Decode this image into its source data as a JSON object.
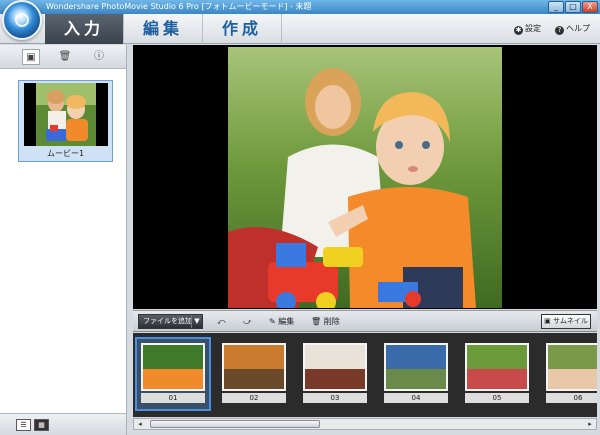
{
  "window": {
    "title": "Wondershare PhotoMovie Studio 6 Pro [フォトムービーモード] - 未題",
    "min": "_",
    "max": "□",
    "close": "X"
  },
  "tabs": [
    {
      "label": "入力"
    },
    {
      "label": "編集"
    },
    {
      "label": "作成"
    }
  ],
  "toolbar": {
    "settings": "設定",
    "help": "ヘルプ"
  },
  "sidebar": {
    "movie_label": "ムービー1"
  },
  "controls": {
    "add_file": "ファイルを追加",
    "edit": "編集",
    "delete": "削除",
    "thumbnail": "サムネイル"
  },
  "filmstrip": [
    {
      "label": "01",
      "colors": [
        "#3f7a2a",
        "#f08a2a"
      ]
    },
    {
      "label": "02",
      "colors": [
        "#c97a2e",
        "#6a4a2a"
      ]
    },
    {
      "label": "03",
      "colors": [
        "#e8e2d8",
        "#7a3a2a"
      ]
    },
    {
      "label": "04",
      "colors": [
        "#3a6aa8",
        "#6a8a4a"
      ]
    },
    {
      "label": "05",
      "colors": [
        "#6a9a3a",
        "#c84a4a"
      ]
    },
    {
      "label": "06",
      "colors": [
        "#7a9a4a",
        "#e8c8a8"
      ]
    }
  ],
  "icons": {
    "settings": "gear-icon",
    "help": "question-icon",
    "edit": "pencil-icon",
    "delete": "trash-icon"
  }
}
